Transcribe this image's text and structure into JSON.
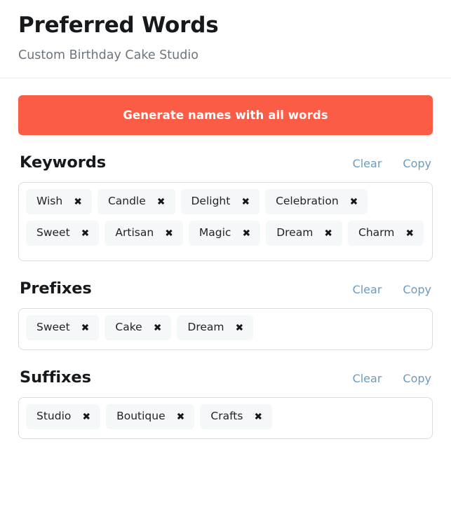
{
  "header": {
    "title": "Preferred Words",
    "subtitle": "Custom Birthday Cake Studio"
  },
  "generate": {
    "label": "Generate names with all words",
    "color": "#fb5c45"
  },
  "actions": {
    "clear_label": "Clear",
    "copy_label": "Copy",
    "link_color": "#6b9cbe",
    "remove_icon": "✖"
  },
  "sections": [
    {
      "id": "keywords",
      "title": "Keywords",
      "clear_label": "Clear",
      "copy_label": "Copy",
      "chips": [
        "Wish",
        "Candle",
        "Delight",
        "Celebration",
        "Sweet",
        "Artisan",
        "Magic",
        "Dream",
        "Charm"
      ]
    },
    {
      "id": "prefixes",
      "title": "Prefixes",
      "clear_label": "Clear",
      "copy_label": "Copy",
      "chips": [
        "Sweet",
        "Cake",
        "Dream"
      ]
    },
    {
      "id": "suffixes",
      "title": "Suffixes",
      "clear_label": "Clear",
      "copy_label": "Copy",
      "chips": [
        "Studio",
        "Boutique",
        "Crafts"
      ]
    }
  ]
}
